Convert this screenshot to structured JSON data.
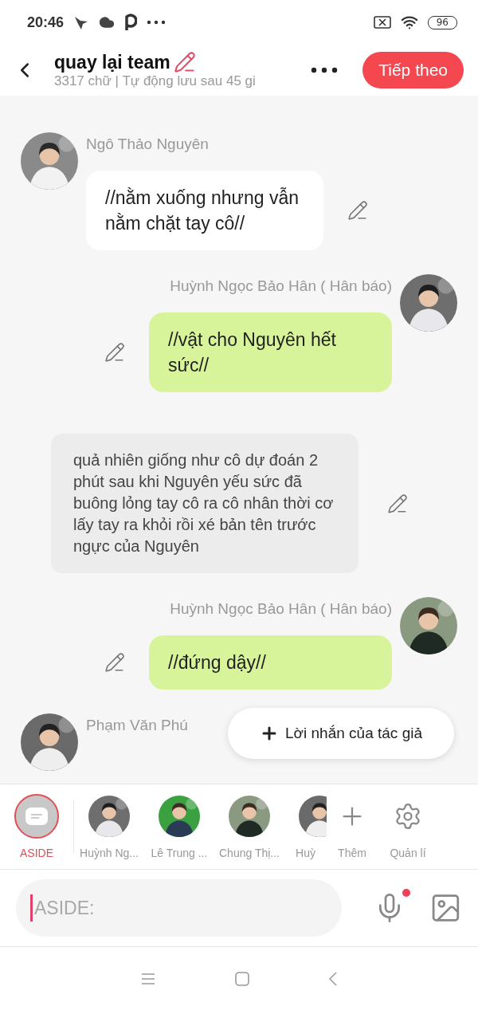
{
  "status_bar": {
    "time": "20:46",
    "battery": "96"
  },
  "header": {
    "title": "quay lại team",
    "subtitle": "3317 chữ | Tự động lưu sau 45 gi",
    "next_button": "Tiếp theo"
  },
  "messages": [
    {
      "kind": "character",
      "outgoing": false,
      "name": "Ngô Thảo Nguyên",
      "text": "//nằm xuống nhưng vẫn nằm chặt tay cô//"
    },
    {
      "kind": "character",
      "outgoing": true,
      "name": "Huỳnh Ngọc Bảo Hân ( Hân báo)",
      "text": "//vật cho Nguyên hết sức//"
    },
    {
      "kind": "narration",
      "text": "quả nhiên giống như cô dự đoán 2 phút sau khi Nguyên yếu sức đã buông lỏng tay cô ra cô nhân thời cơ lấy tay ra khỏi rồi xé bản tên trước ngực của Nguyên"
    },
    {
      "kind": "character",
      "outgoing": true,
      "name": "Huỳnh Ngọc Bảo Hân ( Hân báo)",
      "text": "//đứng dậy//"
    },
    {
      "kind": "character",
      "outgoing": false,
      "name": "Phạm Văn Phú"
    }
  ],
  "author_note_button": "Lời nhắn của tác giả",
  "characters": [
    {
      "kind": "aside",
      "label": "ASIDE",
      "selected": true
    },
    {
      "kind": "person",
      "label": "Huỳnh Ng...",
      "selected": false
    },
    {
      "kind": "person",
      "label": "Lê Trung ...",
      "selected": false
    },
    {
      "kind": "person",
      "label": "Chung Thị...",
      "selected": false
    },
    {
      "kind": "person",
      "label": "Huỳ",
      "selected": false
    }
  ],
  "actions": [
    {
      "kind": "add",
      "label": "Thêm"
    },
    {
      "kind": "manage",
      "label": "Quản lí"
    }
  ],
  "composer": {
    "placeholder": "ASIDE:"
  }
}
